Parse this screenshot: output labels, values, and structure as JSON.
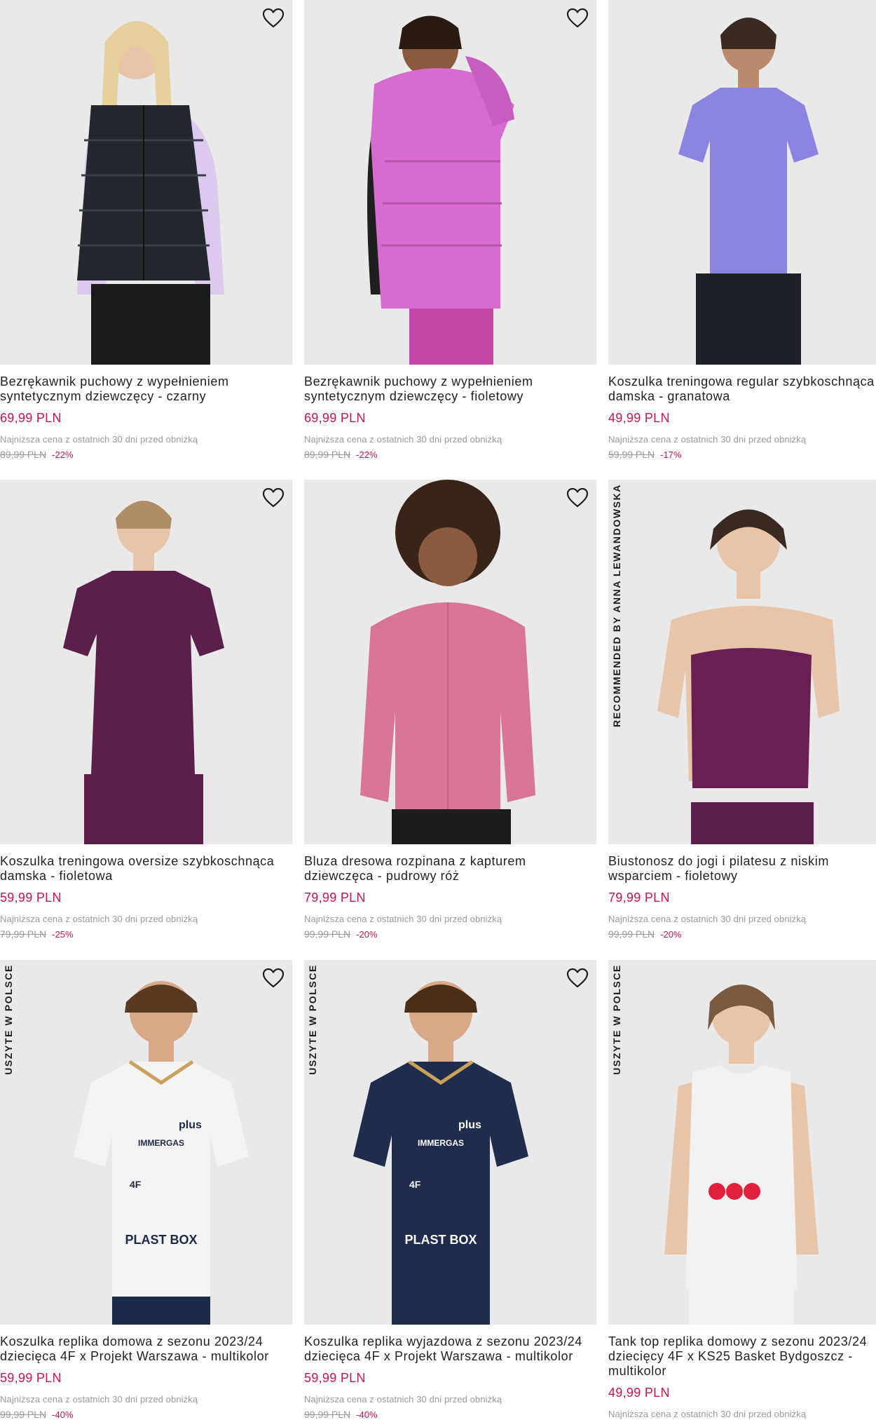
{
  "lowest_price_note": "Najniższa cena z ostatnich 30 dni przed obniżką",
  "colors": {
    "price": "#c8174b",
    "muted": "#9a9a9a",
    "photo_bg": "#e9e9e9"
  },
  "products": [
    {
      "title_line1": "Bezrękawnik puchowy z wypełnieniem",
      "title_line2": "syntetycznym dziewczęcy - czarny",
      "title_line3": "",
      "price": "69,99 PLN",
      "old_price": "89,99 PLN",
      "discount": "-22%",
      "badge": "",
      "favorite_icon": "heart-icon"
    },
    {
      "title_line1": "Bezrękawnik puchowy z wypełnieniem",
      "title_line2": "syntetycznym dziewczęcy - fioletowy",
      "title_line3": "",
      "price": "69,99 PLN",
      "old_price": "89,99 PLN",
      "discount": "-22%",
      "badge": "",
      "favorite_icon": "heart-icon"
    },
    {
      "title_line1": "Koszulka treningowa regular szybkoschnąca",
      "title_line2": "damska - granatowa",
      "title_line3": "",
      "price": "49,99 PLN",
      "old_price": "59,99 PLN",
      "discount": "-17%",
      "badge": "",
      "favorite_icon": "heart-icon"
    },
    {
      "title_line1": "Koszulka treningowa oversize szybkoschnąca",
      "title_line2": "damska - fioletowa",
      "title_line3": "",
      "price": "59,99 PLN",
      "old_price": "79,99 PLN",
      "discount": "-25%",
      "badge": "",
      "favorite_icon": "heart-icon"
    },
    {
      "title_line1": "Bluza dresowa rozpinana z kapturem",
      "title_line2": "dziewczęca - pudrowy róż",
      "title_line3": "",
      "price": "79,99 PLN",
      "old_price": "99,99 PLN",
      "discount": "-20%",
      "badge": "",
      "favorite_icon": "heart-icon"
    },
    {
      "title_line1": "Biustonosz do jogi i pilatesu z niskim",
      "title_line2": "wsparciem - fioletowy",
      "title_line3": "",
      "price": "79,99 PLN",
      "old_price": "99,99 PLN",
      "discount": "-20%",
      "badge": "RECOMMENDED BY ANNA LEWANDOWSKA",
      "favorite_icon": "heart-icon"
    },
    {
      "title_line1": "Koszulka replika domowa z sezonu 2023/24",
      "title_line2": "dziecięca 4F x Projekt Warszawa - multikolor",
      "title_line3": "",
      "price": "59,99 PLN",
      "old_price": "99,99 PLN",
      "discount": "-40%",
      "badge": "USZYTE W POLSCE",
      "favorite_icon": "heart-icon"
    },
    {
      "title_line1": "Koszulka replika wyjazdowa z sezonu 2023/24",
      "title_line2": "dziecięca 4F x Projekt Warszawa - multikolor",
      "title_line3": "",
      "price": "59,99 PLN",
      "old_price": "99,99 PLN",
      "discount": "-40%",
      "badge": "USZYTE W POLSCE",
      "favorite_icon": "heart-icon"
    },
    {
      "title_line1": "Tank top replika domowy z sezonu 2023/24",
      "title_line2": "dziecięcy 4F x KS25 Basket Bydgoszcz -",
      "title_line3": "multikolor",
      "price": "49,99 PLN",
      "old_price": "",
      "discount": "",
      "badge": "USZYTE W POLSCE",
      "favorite_icon": "heart-icon"
    }
  ],
  "jersey_prints": {
    "sponsor_top": "plus",
    "sponsor_main": "IMMERGAS",
    "sponsor_bottom": "PLAST BOX",
    "brand": "4F"
  }
}
